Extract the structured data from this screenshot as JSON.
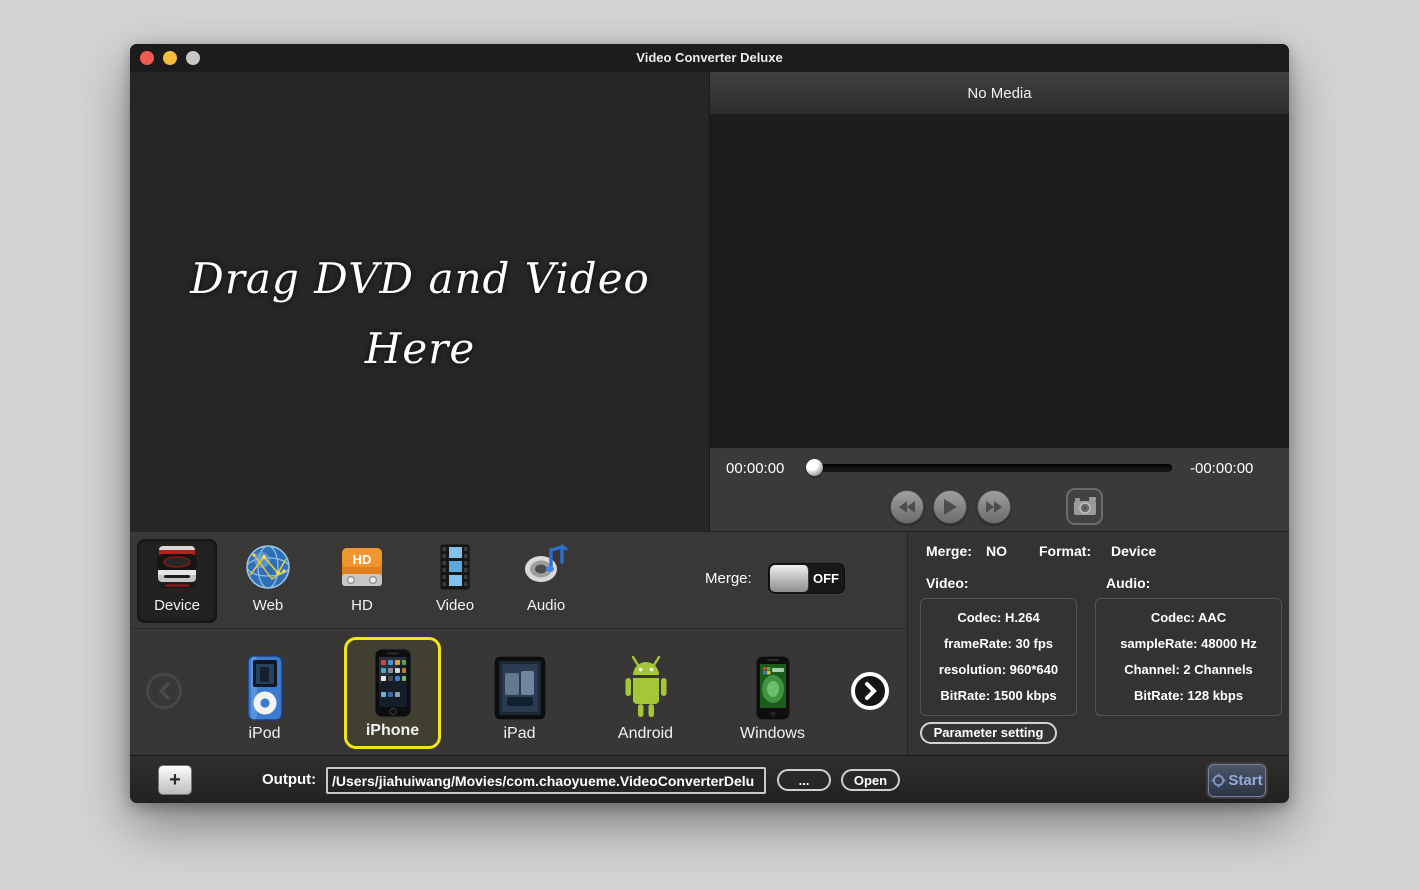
{
  "window": {
    "title": "Video Converter Deluxe"
  },
  "drop_area": {
    "line1": "Drag DVD and Video",
    "line2": "Here"
  },
  "preview": {
    "header": "No Media",
    "time_elapsed": "00:00:00",
    "time_remaining": "-00:00:00"
  },
  "toolbar": {
    "tabs": [
      {
        "label": "Device"
      },
      {
        "label": "Web"
      },
      {
        "label": "HD"
      },
      {
        "label": "Video"
      },
      {
        "label": "Audio"
      }
    ],
    "selected_tab": "Device",
    "merge_label": "Merge:",
    "merge_state": "OFF"
  },
  "carousel": {
    "devices": [
      {
        "label": "iPod"
      },
      {
        "label": "iPhone"
      },
      {
        "label": "iPad"
      },
      {
        "label": "Android"
      },
      {
        "label": "Windows"
      }
    ],
    "selected_device": "iPhone",
    "selection_color": "#f1e41d"
  },
  "info": {
    "merge_label": "Merge:",
    "merge_value": "NO",
    "format_label": "Format:",
    "format_value": "Device",
    "video_label": "Video:",
    "audio_label": "Audio:",
    "video_rows": [
      "Codec: H.264",
      "frameRate: 30 fps",
      "resolution: 960*640",
      "BitRate: 1500 kbps"
    ],
    "audio_rows": [
      "Codec: AAC",
      "sampleRate: 48000 Hz",
      "Channel: 2 Channels",
      "BitRate: 128 kbps"
    ],
    "parameter_button": "Parameter setting"
  },
  "bottom_bar": {
    "add_button": "+",
    "output_label": "Output:",
    "output_path": "/Users/jiahuiwang/Movies/com.chaoyueme.VideoConverterDelu",
    "browse_button": "...",
    "open_button": "Open",
    "start_button": "Start"
  }
}
